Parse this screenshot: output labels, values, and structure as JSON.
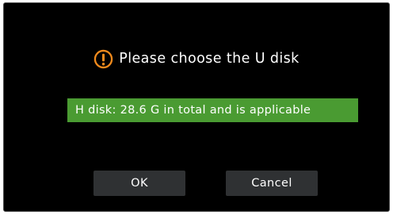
{
  "dialog": {
    "icon": "exclamation-circle-icon",
    "title": "Please choose the U disk",
    "accent_color": "#f08a1c",
    "disk_items": [
      {
        "label": "H disk: 28.6 G in total and is applicable",
        "selected": true
      }
    ],
    "selected_color": "#4a9b32",
    "buttons": {
      "ok_label": "OK",
      "cancel_label": "Cancel"
    }
  }
}
